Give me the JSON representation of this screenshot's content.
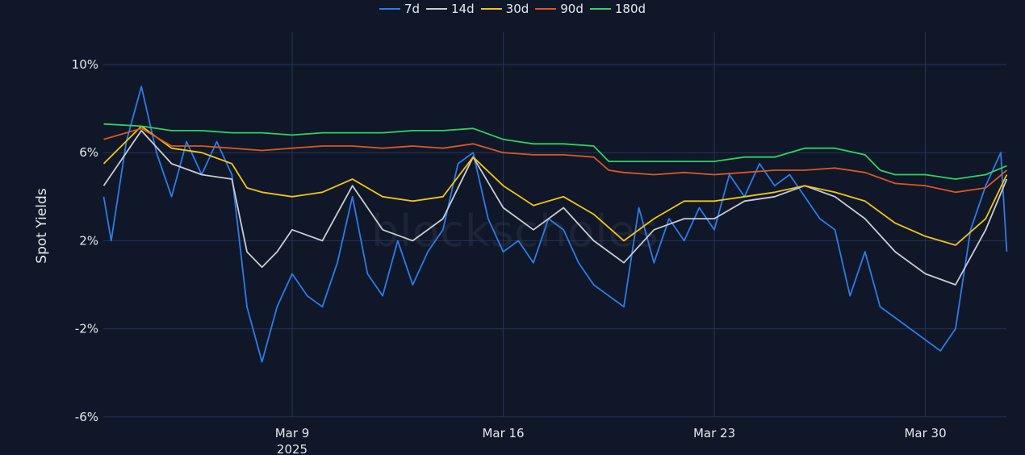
{
  "chart_data": {
    "type": "line",
    "title": "",
    "xlabel": "",
    "ylabel": "Spot Yields",
    "xlim": [
      2.75,
      32.7
    ],
    "ylim": [
      -6.3,
      10.8
    ],
    "grid": true,
    "legend_position": "top-center",
    "x_unit": "day of March 2025 (32 = Apr 1)",
    "x_ticks": [
      {
        "value": 9,
        "label": "Mar 9",
        "sublabel": "2025"
      },
      {
        "value": 16,
        "label": "Mar 16",
        "sublabel": ""
      },
      {
        "value": 23,
        "label": "Mar 23",
        "sublabel": ""
      },
      {
        "value": 30,
        "label": "Mar 30",
        "sublabel": ""
      }
    ],
    "y_ticks": [
      {
        "value": 10,
        "label": "10%"
      },
      {
        "value": 6,
        "label": "6%"
      },
      {
        "value": 2,
        "label": "2%"
      },
      {
        "value": -2,
        "label": "-2%"
      },
      {
        "value": -6,
        "label": "-6%"
      }
    ],
    "watermark": "blockscholes",
    "series": [
      {
        "name": "7d",
        "color": "#2f7be6",
        "x": [
          2.75,
          3,
          3.5,
          4,
          4.5,
          5,
          5.5,
          6,
          6.5,
          7,
          7.5,
          8,
          8.5,
          9,
          9.5,
          10,
          10.5,
          11,
          11.5,
          12,
          12.5,
          13,
          13.5,
          14,
          14.5,
          15,
          15.5,
          16,
          16.5,
          17,
          17.5,
          18,
          18.5,
          19,
          19.5,
          20,
          20.5,
          21,
          21.5,
          22,
          22.5,
          23,
          23.5,
          24,
          24.5,
          25,
          25.5,
          26,
          26.5,
          27,
          27.5,
          28,
          28.5,
          29,
          29.5,
          30,
          30.5,
          31,
          31.5,
          32,
          32.5,
          32.7
        ],
        "y": [
          4.0,
          2.0,
          6.5,
          9.0,
          6.0,
          4.0,
          6.5,
          5.0,
          6.5,
          5.0,
          -1.0,
          -3.5,
          -1.0,
          0.5,
          -0.5,
          -1.0,
          1.0,
          4.0,
          0.5,
          -0.5,
          2.0,
          0.0,
          1.5,
          2.5,
          5.5,
          6.0,
          3.0,
          1.5,
          2.0,
          1.0,
          3.0,
          2.5,
          1.0,
          0.0,
          -0.5,
          -1.0,
          3.5,
          1.0,
          3.0,
          2.0,
          3.5,
          2.5,
          5.0,
          4.0,
          5.5,
          4.5,
          5.0,
          4.0,
          3.0,
          2.5,
          -0.5,
          1.5,
          -1.0,
          -1.5,
          -2.0,
          -2.5,
          -3.0,
          -2.0,
          2.5,
          4.5,
          6.0,
          1.5
        ]
      },
      {
        "name": "14d",
        "color": "#c9ccd3",
        "x": [
          2.75,
          4,
          5,
          6,
          7,
          7.5,
          8,
          8.5,
          9,
          10,
          11,
          12,
          13,
          14,
          15,
          16,
          17,
          18,
          19,
          20,
          21,
          22,
          23,
          24,
          25,
          26,
          27,
          28,
          29,
          30,
          31,
          32,
          32.7
        ],
        "y": [
          4.5,
          7.0,
          5.5,
          5.0,
          4.8,
          1.5,
          0.8,
          1.5,
          2.5,
          2.0,
          4.5,
          2.5,
          2.0,
          3.0,
          5.8,
          3.5,
          2.5,
          3.5,
          2.0,
          1.0,
          2.5,
          3.0,
          3.0,
          3.8,
          4.0,
          4.5,
          4.0,
          3.0,
          1.5,
          0.5,
          0.0,
          2.5,
          4.8
        ]
      },
      {
        "name": "30d",
        "color": "#f2c318",
        "x": [
          2.75,
          4,
          5,
          6,
          7,
          7.5,
          8,
          9,
          10,
          11,
          12,
          13,
          14,
          15,
          16,
          17,
          18,
          19,
          20,
          21,
          22,
          23,
          24,
          25,
          26,
          27,
          28,
          29,
          30,
          31,
          32,
          32.7
        ],
        "y": [
          5.5,
          7.2,
          6.2,
          6.0,
          5.5,
          4.4,
          4.2,
          4.0,
          4.2,
          4.8,
          4.0,
          3.8,
          4.0,
          5.8,
          4.5,
          3.6,
          4.0,
          3.2,
          2.0,
          3.0,
          3.8,
          3.8,
          4.0,
          4.2,
          4.5,
          4.2,
          3.8,
          2.8,
          2.2,
          1.8,
          3.0,
          5.0
        ]
      },
      {
        "name": "90d",
        "color": "#d9581f",
        "x": [
          2.75,
          4,
          5,
          6,
          7,
          8,
          9,
          10,
          11,
          12,
          13,
          14,
          15,
          16,
          17,
          18,
          19,
          19.5,
          20,
          21,
          22,
          23,
          24,
          25,
          26,
          27,
          28,
          29,
          30,
          31,
          32,
          32.7
        ],
        "y": [
          6.6,
          7.1,
          6.3,
          6.3,
          6.2,
          6.1,
          6.2,
          6.3,
          6.3,
          6.2,
          6.3,
          6.2,
          6.4,
          6.0,
          5.9,
          5.9,
          5.8,
          5.2,
          5.1,
          5.0,
          5.1,
          5.0,
          5.1,
          5.2,
          5.2,
          5.3,
          5.1,
          4.6,
          4.5,
          4.2,
          4.4,
          5.2
        ]
      },
      {
        "name": "180d",
        "color": "#2fd35e",
        "x": [
          2.75,
          4,
          5,
          6,
          7,
          8,
          9,
          10,
          11,
          12,
          13,
          14,
          15,
          16,
          17,
          18,
          19,
          19.5,
          20,
          21,
          22,
          23,
          24,
          25,
          26,
          27,
          28,
          28.5,
          29,
          30,
          31,
          32,
          32.7
        ],
        "y": [
          7.3,
          7.2,
          7.0,
          7.0,
          6.9,
          6.9,
          6.8,
          6.9,
          6.9,
          6.9,
          7.0,
          7.0,
          7.1,
          6.6,
          6.4,
          6.4,
          6.3,
          5.6,
          5.6,
          5.6,
          5.6,
          5.6,
          5.8,
          5.8,
          6.2,
          6.2,
          5.9,
          5.2,
          5.0,
          5.0,
          4.8,
          5.0,
          5.4
        ]
      }
    ]
  }
}
